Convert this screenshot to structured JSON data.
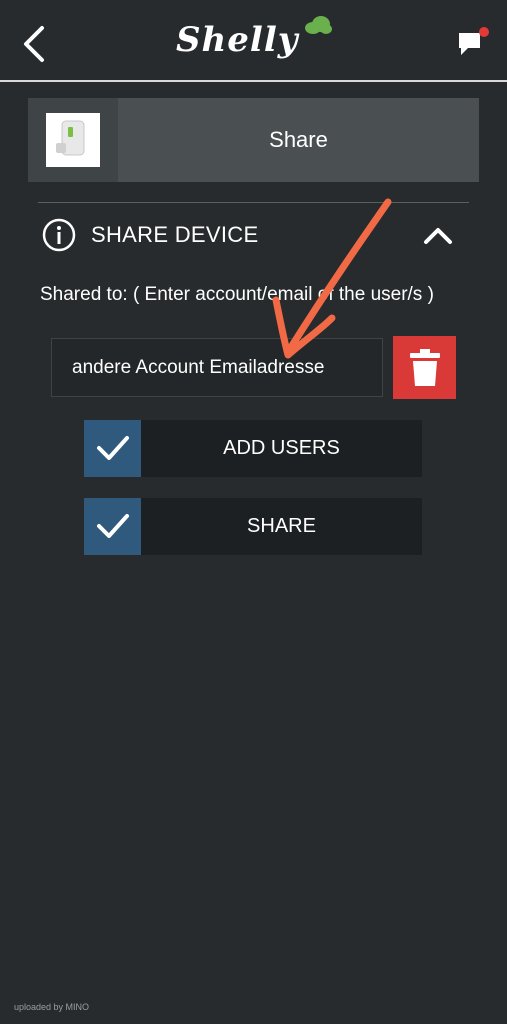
{
  "header": {
    "logo_text": "Shelly",
    "back_icon": "chevron-left-icon",
    "chat_icon": "chat-bubble-icon",
    "notification_color": "#e53935"
  },
  "device": {
    "title": "Share",
    "thumb_icon": "plug-device-icon"
  },
  "section": {
    "title": "SHARE DEVICE",
    "info_icon": "info-icon",
    "collapse_icon": "chevron-up-icon"
  },
  "share_form": {
    "label": "Shared to: ( Enter account/email of the user/s )",
    "email_value": "andere Account Emailadresse",
    "delete_icon": "trash-icon",
    "delete_color": "#d93a37"
  },
  "actions": {
    "add_users_label": "ADD USERS",
    "share_label": "SHARE",
    "check_color": "#2f5a7e"
  },
  "annotation": {
    "arrow_color": "#f26a45"
  },
  "watermark": "uploaded by MINO"
}
